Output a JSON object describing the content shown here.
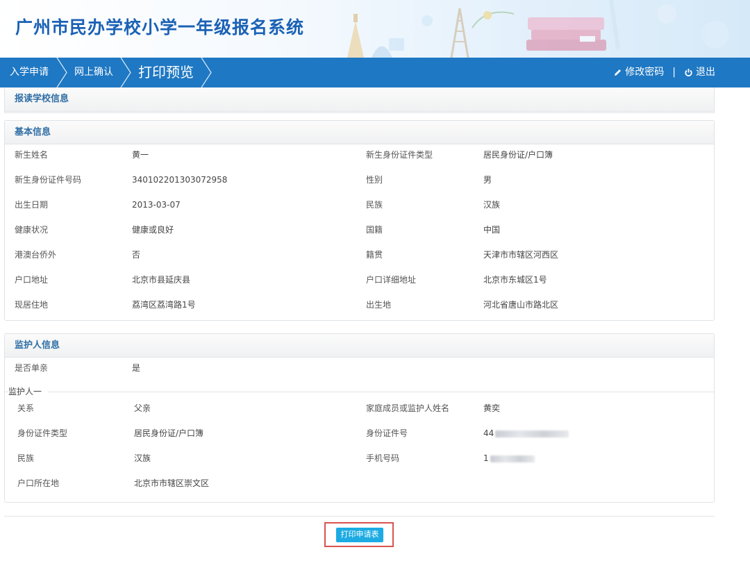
{
  "header": {
    "title": "广州市民办学校小学一年级报名系统"
  },
  "nav": {
    "steps": [
      "入学申请",
      "网上确认",
      "打印预览"
    ],
    "change_password": "修改密码",
    "separator": "|",
    "logout": "退出"
  },
  "school_panel": {
    "title": "报读学校信息"
  },
  "basic_panel": {
    "title": "基本信息",
    "fields": [
      {
        "label": "新生姓名",
        "value": "黄一"
      },
      {
        "label": "新生身份证件类型",
        "value": "居民身份证/户口簿"
      },
      {
        "label": "新生身份证件号码",
        "value": "340102201303072958"
      },
      {
        "label": "性别",
        "value": "男"
      },
      {
        "label": "出生日期",
        "value": "2013-03-07"
      },
      {
        "label": "民族",
        "value": "汉族"
      },
      {
        "label": "健康状况",
        "value": "健康或良好"
      },
      {
        "label": "国籍",
        "value": "中国"
      },
      {
        "label": "港澳台侨外",
        "value": "否"
      },
      {
        "label": "籍贯",
        "value": "天津市市辖区河西区"
      },
      {
        "label": "户口地址",
        "value": "北京市县延庆县"
      },
      {
        "label": "户口详细地址",
        "value": "北京市东城区1号"
      },
      {
        "label": "现居住地",
        "value": "荔湾区荔湾路1号"
      },
      {
        "label": "出生地",
        "value": "河北省唐山市路北区"
      }
    ]
  },
  "guardian_panel": {
    "title": "监护人信息",
    "single_parent": {
      "label": "是否单亲",
      "value": "是"
    },
    "guardian1": {
      "legend": "监护人一",
      "fields": [
        {
          "label": "关系",
          "value": "父亲"
        },
        {
          "label": "家庭成员或监护人姓名",
          "value": "黄奕"
        },
        {
          "label": "身份证件类型",
          "value": "居民身份证/户口簿"
        },
        {
          "label": "身份证件号",
          "value": "44"
        },
        {
          "label": "民族",
          "value": "汉族"
        },
        {
          "label": "手机号码",
          "value": "1"
        },
        {
          "label": "户口所在地",
          "value": "北京市市辖区崇文区"
        }
      ]
    }
  },
  "actions": {
    "print_label": "打印申请表"
  },
  "colors": {
    "nav_bg": "#1f78c3",
    "title": "#1b61b5",
    "button": "#1cabe2",
    "highlight": "#d9534f"
  }
}
